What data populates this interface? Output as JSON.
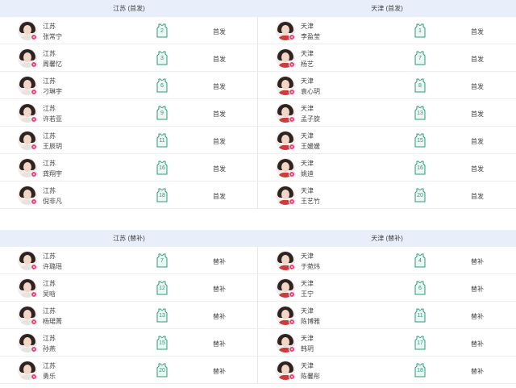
{
  "sections": [
    {
      "id": "starters",
      "left_title": "江苏 (首发)",
      "right_title": "天津 (首发)",
      "left": [
        {
          "team": "江苏",
          "name": "张常宁",
          "number": "2",
          "role": "首发"
        },
        {
          "team": "江苏",
          "name": "周馨忆",
          "number": "3",
          "role": "首发"
        },
        {
          "team": "江苏",
          "name": "刁琳宇",
          "number": "6",
          "role": "首发"
        },
        {
          "team": "江苏",
          "name": "许若亚",
          "number": "9",
          "role": "首发"
        },
        {
          "team": "江苏",
          "name": "王辰玥",
          "number": "11",
          "role": "首发"
        },
        {
          "team": "江苏",
          "name": "龚翔宇",
          "number": "16",
          "role": "首发"
        },
        {
          "team": "江苏",
          "name": "倪非凡",
          "number": "18",
          "role": "首发"
        }
      ],
      "right": [
        {
          "team": "天津",
          "name": "李盈莹",
          "number": "1",
          "role": "首发"
        },
        {
          "team": "天津",
          "name": "杨艺",
          "number": "7",
          "role": "首发"
        },
        {
          "team": "天津",
          "name": "袁心玥",
          "number": "8",
          "role": "首发"
        },
        {
          "team": "天津",
          "name": "孟子旋",
          "number": "13",
          "role": "首发"
        },
        {
          "team": "天津",
          "name": "王媛媛",
          "number": "15",
          "role": "首发"
        },
        {
          "team": "天津",
          "name": "姚迪",
          "number": "16",
          "role": "首发"
        },
        {
          "team": "天津",
          "name": "王艺竹",
          "number": "20",
          "role": "首发"
        }
      ]
    },
    {
      "id": "subs",
      "left_title": "江苏 (替补)",
      "right_title": "天津 (替补)",
      "left": [
        {
          "team": "江苏",
          "name": "许璐瑶",
          "number": "7",
          "role": "替补"
        },
        {
          "team": "江苏",
          "name": "吴晗",
          "number": "12",
          "role": "替补"
        },
        {
          "team": "江苏",
          "name": "杨珺菁",
          "number": "13",
          "role": "替补"
        },
        {
          "team": "江苏",
          "name": "孙燕",
          "number": "15",
          "role": "替补"
        },
        {
          "team": "江苏",
          "name": "勇乐",
          "number": "20",
          "role": "替补"
        }
      ],
      "right": [
        {
          "team": "天津",
          "name": "于菀炜",
          "number": "4",
          "role": "替补"
        },
        {
          "team": "天津",
          "name": "王宁",
          "number": "6",
          "role": "替补"
        },
        {
          "team": "天津",
          "name": "陈博雅",
          "number": "11",
          "role": "替补"
        },
        {
          "team": "天津",
          "name": "韩玥",
          "number": "17",
          "role": "替补"
        },
        {
          "team": "天津",
          "name": "陈馨彤",
          "number": "18",
          "role": "替补"
        }
      ]
    }
  ],
  "colors": {
    "header_bg": "#e8eefa",
    "jersey": "#2e9a7c",
    "badge": "#f0437a",
    "tianjin_kit": "#cf3a3a"
  },
  "icons": {
    "jersey": "jersey-icon",
    "badge": "player-badge-icon",
    "avatar": "player-photo"
  }
}
